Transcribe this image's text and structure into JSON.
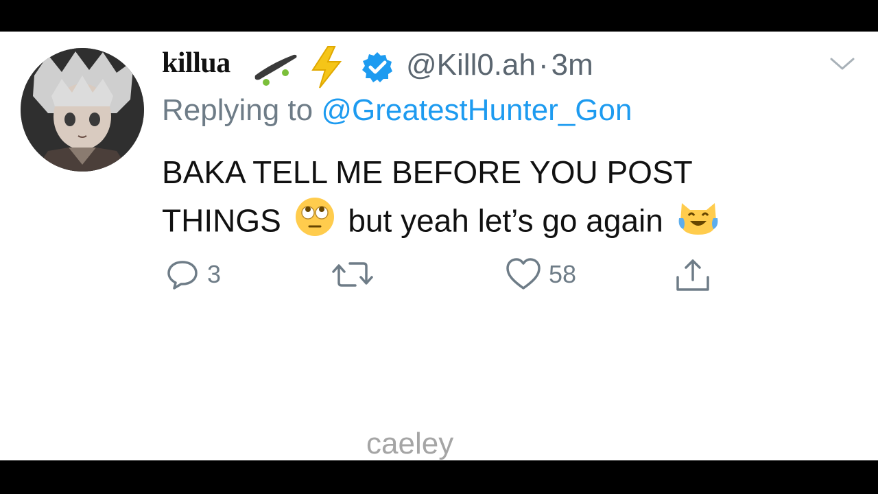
{
  "tweet": {
    "display_name": "killua",
    "name_decorations": [
      "skateboard-emoji",
      "lightning-emoji"
    ],
    "verified": true,
    "handle": "@Kill0.ah",
    "separator": "·",
    "time": "3m",
    "reply_prefix": "Replying to ",
    "reply_to": "@GreatestHunter_Gon",
    "text_line1": "BAKA TELL ME BEFORE YOU POST",
    "text_line2_a": "THINGS",
    "text_line2_b": "but yeah let’s go again",
    "emojis": [
      "face-with-rolling-eyes",
      "cat-with-tears-of-joy"
    ]
  },
  "actions": {
    "replies": "3",
    "retweets": "",
    "likes": "58"
  },
  "watermark": "caeley",
  "colors": {
    "link_blue": "#1d9bf0",
    "secondary_text": "#6e7c87",
    "primary_text": "#111111",
    "background": "#ffffff",
    "letterbox": "#000000"
  }
}
